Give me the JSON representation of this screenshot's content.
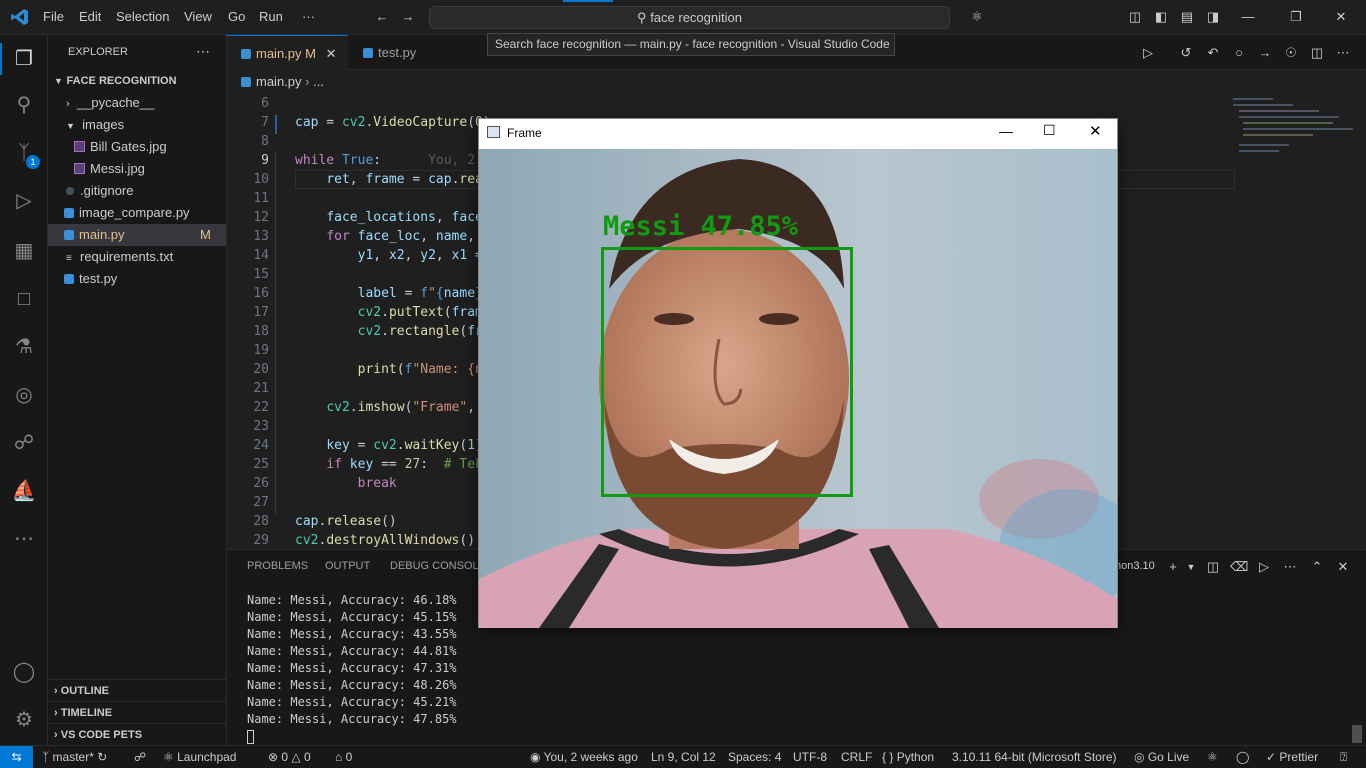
{
  "titlebar": {
    "menu": [
      "File",
      "Edit",
      "Selection",
      "View",
      "Go",
      "Run",
      "···"
    ],
    "search_text": "face recognition",
    "tooltip": "Search face recognition — main.py - face recognition - Visual Studio Code"
  },
  "activity": {
    "scm_badge": "1"
  },
  "sidebar": {
    "header": "EXPLORER",
    "project": "FACE RECOGNITION",
    "items": [
      {
        "label": "__pycache__",
        "type": "folder-closed"
      },
      {
        "label": "images",
        "type": "folder-open"
      },
      {
        "label": "Bill Gates.jpg",
        "type": "image"
      },
      {
        "label": "Messi.jpg",
        "type": "image"
      },
      {
        "label": ".gitignore",
        "type": "git"
      },
      {
        "label": "image_compare.py",
        "type": "python"
      },
      {
        "label": "main.py",
        "type": "python",
        "badge": "M"
      },
      {
        "label": "requirements.txt",
        "type": "text"
      },
      {
        "label": "test.py",
        "type": "python"
      }
    ],
    "sections": [
      "OUTLINE",
      "TIMELINE",
      "VS CODE PETS"
    ]
  },
  "tabs": [
    {
      "label": "main.py",
      "badge": "M"
    },
    {
      "label": "test.py"
    }
  ],
  "breadcrumb": {
    "file": "main.py",
    "rest": "..."
  },
  "editor": {
    "line_numbers": [
      "6",
      "7",
      "8",
      "9",
      "10",
      "11",
      "12",
      "13",
      "14",
      "15",
      "16",
      "17",
      "18",
      "19",
      "20",
      "21",
      "22",
      "23",
      "24",
      "25",
      "26",
      "27",
      "28",
      "29"
    ],
    "blame": "You, 2"
  },
  "panel": {
    "tabs": [
      "PROBLEMS",
      "OUTPUT",
      "DEBUG CONSOLE"
    ],
    "shell_label": "hon3.10",
    "output": [
      "Name: Messi, Accuracy: 46.18%",
      "Name: Messi, Accuracy: 45.15%",
      "Name: Messi, Accuracy: 43.55%",
      "Name: Messi, Accuracy: 44.81%",
      "Name: Messi, Accuracy: 47.31%",
      "Name: Messi, Accuracy: 48.26%",
      "Name: Messi, Accuracy: 45.21%",
      "Name: Messi, Accuracy: 47.85%"
    ]
  },
  "frame_window": {
    "title": "Frame",
    "overlay_label": "Messi 47.85%",
    "box_color": "#109b10"
  },
  "statusbar": {
    "branch": "master*",
    "launchpad": "Launchpad",
    "errors": "0",
    "warnings": "0",
    "ports": "0",
    "blame": "You, 2 weeks ago",
    "position": "Ln 9, Col 12",
    "spaces": "Spaces: 4",
    "encoding": "UTF-8",
    "eol": "CRLF",
    "language": "Python",
    "interpreter": "3.10.11 64-bit (Microsoft Store)",
    "golive": "Go Live",
    "prettier": "Prettier"
  },
  "colors": {
    "accent": "#0078d4",
    "keyword": "#c586c0",
    "function": "#dcdcaa"
  }
}
